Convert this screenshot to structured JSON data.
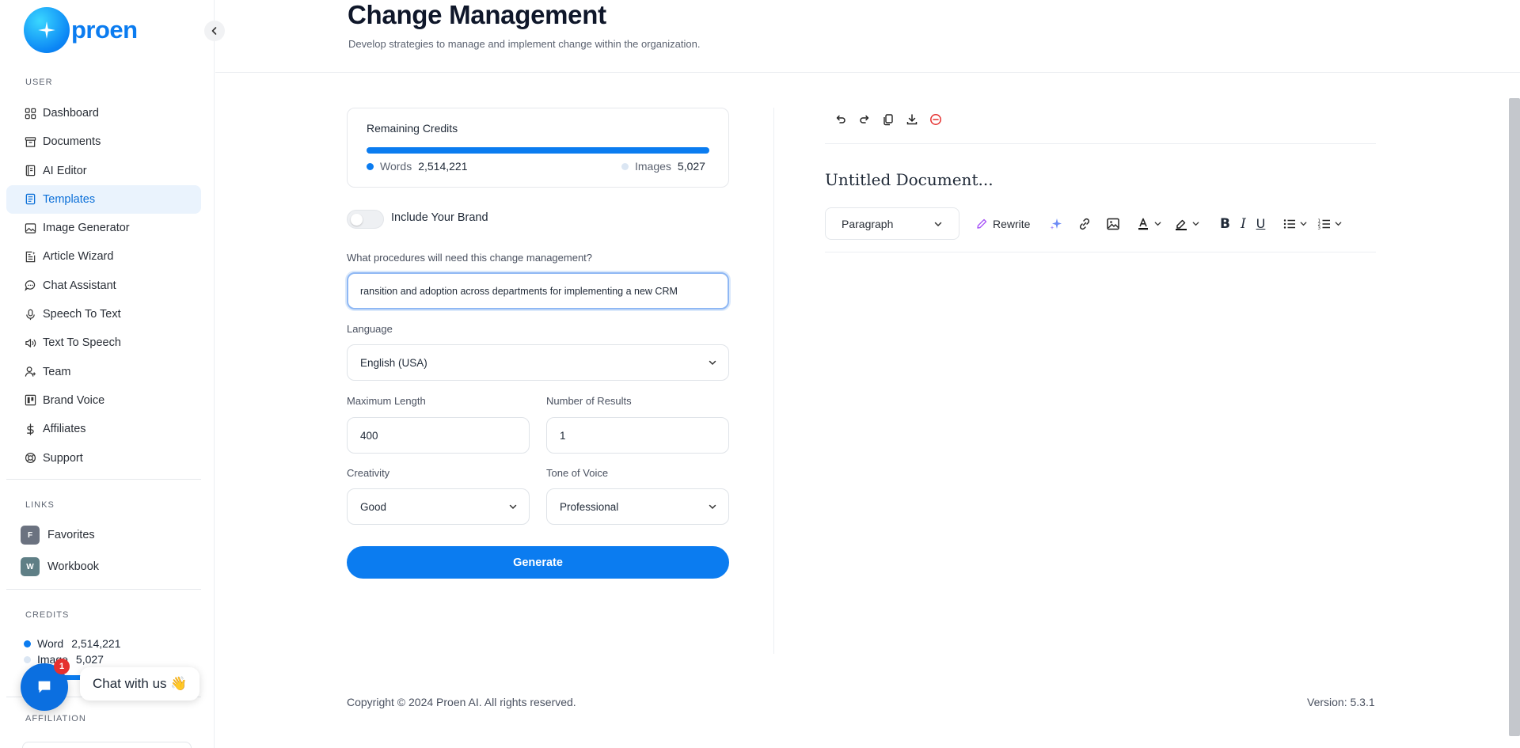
{
  "brand": {
    "name": "proen"
  },
  "sidebar": {
    "user_label": "USER",
    "items": [
      {
        "label": "Dashboard",
        "icon": "grid-icon",
        "active": false
      },
      {
        "label": "Documents",
        "icon": "archive-icon",
        "active": false
      },
      {
        "label": "AI Editor",
        "icon": "book-icon",
        "active": false
      },
      {
        "label": "Templates",
        "icon": "document-icon",
        "active": true
      },
      {
        "label": "Image Generator",
        "icon": "image-icon",
        "active": false
      },
      {
        "label": "Article Wizard",
        "icon": "article-icon",
        "active": false
      },
      {
        "label": "Chat Assistant",
        "icon": "chat-icon",
        "active": false
      },
      {
        "label": "Speech To Text",
        "icon": "microphone-icon",
        "active": false
      },
      {
        "label": "Text To Speech",
        "icon": "speaker-icon",
        "active": false
      },
      {
        "label": "Team",
        "icon": "user-plus-icon",
        "active": false
      },
      {
        "label": "Brand Voice",
        "icon": "columns-icon",
        "active": false
      },
      {
        "label": "Affiliates",
        "icon": "dollar-icon",
        "active": false
      },
      {
        "label": "Support",
        "icon": "lifebuoy-icon",
        "active": false
      }
    ],
    "links_label": "LINKS",
    "links": [
      {
        "badge": "F",
        "label": "Favorites",
        "color": "#6b7280"
      },
      {
        "badge": "W",
        "label": "Workbook",
        "color": "#5f7f86"
      }
    ],
    "credits_label": "CREDITS",
    "credits": {
      "word_label": "Word",
      "word_value": "2,514,221",
      "image_label": "Image",
      "image_value": "5,027"
    },
    "affiliation_label": "AFFILIATION"
  },
  "chat_widget": {
    "badge": "1",
    "text": "Chat with us 👋"
  },
  "header": {
    "title": "Change Management",
    "subtitle": "Develop strategies to manage and implement change within the organization."
  },
  "form": {
    "credits_card": {
      "title": "Remaining Credits",
      "words_label": "Words",
      "words_value": "2,514,221",
      "images_label": "Images",
      "images_value": "5,027",
      "words_color": "#0b7cf0",
      "images_color": "#dbe6f3"
    },
    "brand_toggle": {
      "label": "Include Your Brand",
      "on": false
    },
    "procedures": {
      "label": "What procedures will need this change management?",
      "value": "ransition and adoption across departments for implementing a new CRM"
    },
    "language": {
      "label": "Language",
      "value": "English (USA)"
    },
    "max_length": {
      "label": "Maximum Length",
      "value": "400"
    },
    "num_results": {
      "label": "Number of Results",
      "value": "1"
    },
    "creativity": {
      "label": "Creativity",
      "value": "Good"
    },
    "tone": {
      "label": "Tone of Voice",
      "value": "Professional"
    },
    "generate_label": "Generate"
  },
  "editor": {
    "doc_title": "Untitled Document...",
    "paragraph_select": "Paragraph",
    "rewrite_label": "Rewrite"
  },
  "footer": {
    "copyright": "Copyright © 2024 Proen AI. All rights reserved.",
    "version": "Version: 5.3.1"
  },
  "colors": {
    "accent": "#0b7cf0",
    "active_bg": "#eaf3fd",
    "danger": "#e5302f"
  }
}
